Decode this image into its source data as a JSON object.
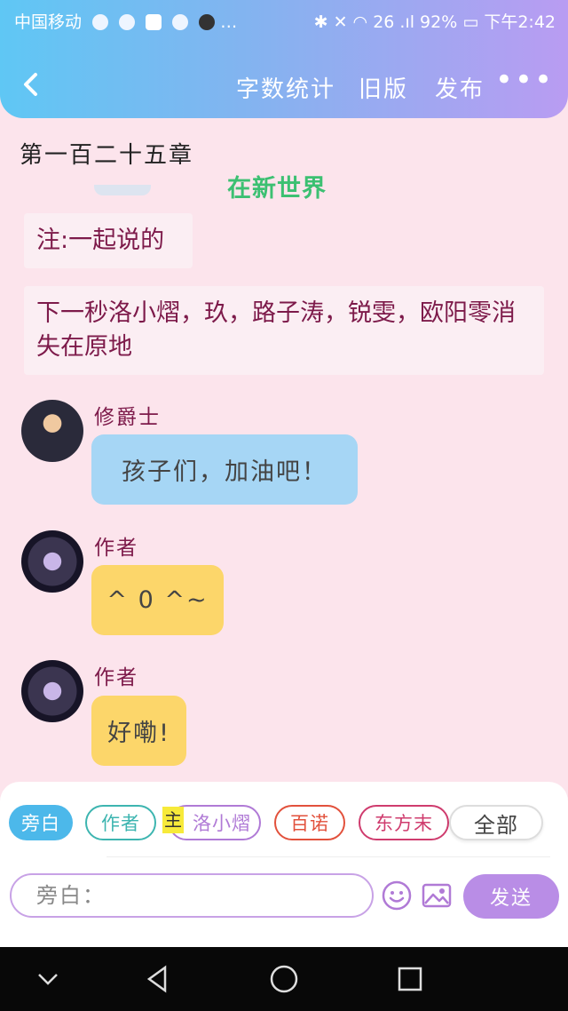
{
  "status_bar": {
    "carrier": "中国移动",
    "right_text": "26 .ıl 92%",
    "time": "下午2:42"
  },
  "nav": {
    "back_icon": "chevron-left-icon",
    "word_count": "字数统计",
    "old_version": "旧版",
    "publish": "发布",
    "more": "•••"
  },
  "chapter_title": "第一百二十五章",
  "watermark": "在新世界",
  "notes": [
    "注:一起说的",
    "下一秒洛小熠，玖，路子涛，锐雯，欧阳零消失在原地"
  ],
  "messages": [
    {
      "sender": "修爵士",
      "text": "孩子们，加油吧！",
      "color": "#a6d6f5"
    },
    {
      "sender": "作者",
      "text": "^ 0 ^~",
      "color": "#fcd66a"
    },
    {
      "sender": "作者",
      "text": "好嘞!",
      "color": "#fcd66a"
    }
  ],
  "roles": {
    "narration": "旁白",
    "author": "作者",
    "protagonist_mark": "主",
    "luo": "洛小熠",
    "bainuo": "百诺",
    "dongfang": "东方末",
    "all": "全部"
  },
  "composer": {
    "placeholder": "旁白：",
    "emoji_icon": "emoji-icon",
    "image_icon": "image-icon",
    "send": "发送"
  },
  "colors": {
    "narration_chip": "#4cb8ea",
    "author_chip": "#3db5b0",
    "luo_chip": "#b07ad6",
    "bainuo_chip": "#e2513c",
    "dongfang_chip": "#cf3c6e",
    "accent": "#b98de6"
  }
}
